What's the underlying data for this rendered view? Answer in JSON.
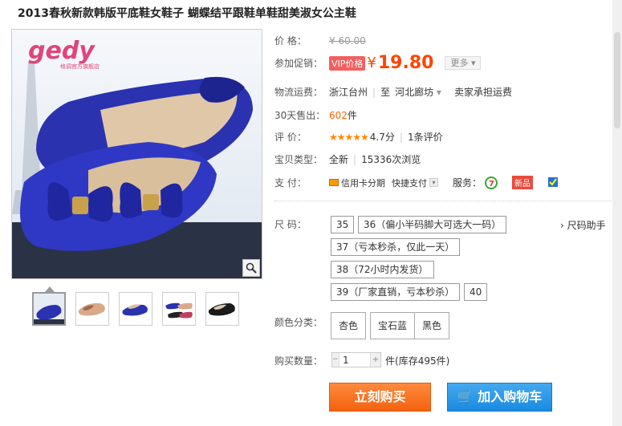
{
  "product": {
    "title": "2013春秋新款韩版平底鞋女鞋子 蝴蝶结平跟鞋单鞋甜美淑女公主鞋",
    "logo_text": "gedy",
    "logo_subtext": "格调官方旗舰店"
  },
  "price_row": {
    "label": "价      格：",
    "original_price": "¥ 60.00"
  },
  "promo_row": {
    "label": "参加促销：",
    "tag": "VIP价格",
    "currency": "¥",
    "price": "19.80",
    "more": "更多"
  },
  "shipping": {
    "label": "物流运费：",
    "from": "浙江台州",
    "to_prefix": "至",
    "to": "河北廊坊",
    "fee": "卖家承担运费"
  },
  "sales": {
    "label": "30天售出：",
    "count": "602",
    "unit": "件"
  },
  "rating": {
    "label": "评      价：",
    "stars": "★★★★★",
    "score": "4.7分",
    "reviews": "1条评价"
  },
  "item_type": {
    "label": "宝贝类型：",
    "condition": "全新",
    "views": "15336次浏览"
  },
  "payment": {
    "label": "支      付：",
    "credit": "信用卡分期",
    "quick": "快捷支付",
    "service_label": "服务：",
    "new_badge": "新品"
  },
  "size": {
    "label": "尺      码：",
    "helper": "尺码助手",
    "options": [
      "35",
      "36（偏小半码脚大可选大一码）",
      "37（亏本秒杀，仅此一天）",
      "38（72小时内发货）",
      "39（厂家直销，亏本秒杀）",
      "40"
    ]
  },
  "color": {
    "label": "颜色分类：",
    "options": [
      "杏色",
      "宝石蓝",
      "黑色"
    ]
  },
  "quantity": {
    "label": "购买数量：",
    "value": "1",
    "unit": "件",
    "stock": "(库存495件)"
  },
  "actions": {
    "buy": "立刻购买",
    "cart": "加入购物车"
  },
  "colors": {
    "accent": "#ff4400",
    "buy": "#f2620f",
    "cart": "#1a8ae0",
    "shoe_blue": "#2a32b0"
  }
}
